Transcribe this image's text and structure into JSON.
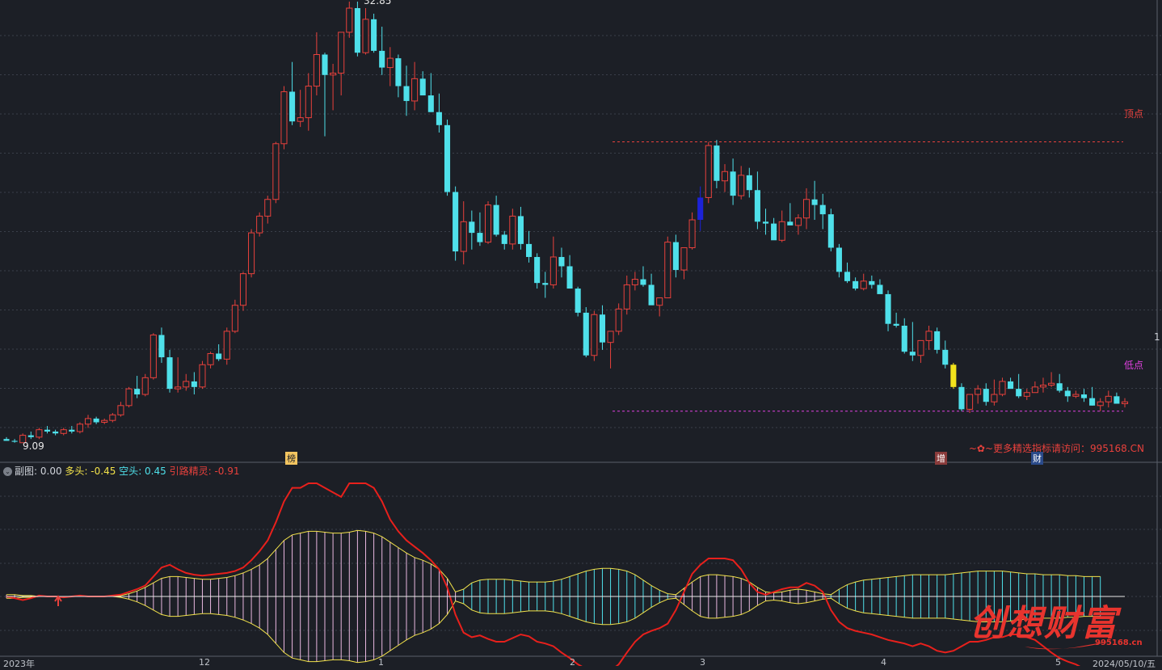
{
  "header": {
    "sub_label": "副图",
    "sub_value": ": 0.00",
    "duo_label": "多头",
    "duo_value": ": -0.45",
    "kong_label": "空头",
    "kong_value": ": 0.45",
    "yin_label": "引路精灵",
    "yin_value": ": -0.91",
    "promo": "~✿~更多精选指标请访问：995168.CN"
  },
  "markers": {
    "top_label": "顶点",
    "low_label": "低点",
    "low_price": "9.09",
    "high_price": "32.85",
    "right_tick": "1",
    "tag_bang": "榜",
    "tag_zeng": "增",
    "tag_cai": "财"
  },
  "x_ticks": [
    "2023年",
    "12",
    "1",
    "2",
    "3",
    "4",
    "5",
    "2024/05/10/五"
  ],
  "watermark": {
    "text": "创想财富",
    "url": "995168.cn"
  },
  "colors": {
    "up": "#e8413c",
    "down": "#4fe0ea",
    "hl_blue": "#1c22d8",
    "hl_yellow": "#f2e31c",
    "duo_fill": "#e9b7e0",
    "kong_fill": "#4fe0ea",
    "line_red": "#e8201c",
    "grid": "#3a3f4a"
  },
  "chart_data": {
    "type": "candlestick",
    "price_range": [
      9.09,
      32.85
    ],
    "top_level": 25.3,
    "low_level": 10.8,
    "candles": [
      [
        9.3,
        9.4,
        9.2,
        9.2
      ],
      [
        9.2,
        9.3,
        9.1,
        9.15
      ],
      [
        9.1,
        9.6,
        9.09,
        9.5
      ],
      [
        9.5,
        9.7,
        9.3,
        9.4
      ],
      [
        9.4,
        9.9,
        9.3,
        9.8
      ],
      [
        9.8,
        10.0,
        9.6,
        9.7
      ],
      [
        9.7,
        9.8,
        9.5,
        9.6
      ],
      [
        9.6,
        9.9,
        9.5,
        9.8
      ],
      [
        9.8,
        10.0,
        9.6,
        9.7
      ],
      [
        9.7,
        10.2,
        9.6,
        10.1
      ],
      [
        10.1,
        10.6,
        9.9,
        10.4
      ],
      [
        10.4,
        10.5,
        10.1,
        10.2
      ],
      [
        10.2,
        10.4,
        10.1,
        10.3
      ],
      [
        10.3,
        10.7,
        10.2,
        10.6
      ],
      [
        10.6,
        11.3,
        10.5,
        11.1
      ],
      [
        11.1,
        12.1,
        11.0,
        12.0
      ],
      [
        12.0,
        12.7,
        11.5,
        11.7
      ],
      [
        11.7,
        12.8,
        11.6,
        12.6
      ],
      [
        12.6,
        15.0,
        12.5,
        14.9
      ],
      [
        14.9,
        15.3,
        13.4,
        13.7
      ],
      [
        13.7,
        14.1,
        11.8,
        12.0
      ],
      [
        12.0,
        13.7,
        11.8,
        12.1
      ],
      [
        12.1,
        12.8,
        11.9,
        12.4
      ],
      [
        12.4,
        12.9,
        11.7,
        12.1
      ],
      [
        12.1,
        13.5,
        12.0,
        13.3
      ],
      [
        13.3,
        14.0,
        13.1,
        13.9
      ],
      [
        13.9,
        14.4,
        13.5,
        13.6
      ],
      [
        13.6,
        15.3,
        13.3,
        15.1
      ],
      [
        15.1,
        16.8,
        15.0,
        16.5
      ],
      [
        16.5,
        18.3,
        16.2,
        18.2
      ],
      [
        18.2,
        20.6,
        18.0,
        20.4
      ],
      [
        20.4,
        21.5,
        20.2,
        21.3
      ],
      [
        21.3,
        22.4,
        20.9,
        22.2
      ],
      [
        22.2,
        25.3,
        22.0,
        25.2
      ],
      [
        25.2,
        28.3,
        24.9,
        28.0
      ],
      [
        28.0,
        29.6,
        26.2,
        26.4
      ],
      [
        26.4,
        28.1,
        26.1,
        26.6
      ],
      [
        26.6,
        29.0,
        25.9,
        28.3
      ],
      [
        28.3,
        31.2,
        27.8,
        30.0
      ],
      [
        30.0,
        30.1,
        25.6,
        28.9
      ],
      [
        28.9,
        29.5,
        27.0,
        29.0
      ],
      [
        29.0,
        31.1,
        27.8,
        31.2
      ],
      [
        31.2,
        32.85,
        30.9,
        32.5
      ],
      [
        32.5,
        32.85,
        29.9,
        30.1
      ],
      [
        30.1,
        32.5,
        30.0,
        31.9
      ],
      [
        31.9,
        32.2,
        30.1,
        30.2
      ],
      [
        30.2,
        31.5,
        28.9,
        29.3
      ],
      [
        29.3,
        30.4,
        28.3,
        29.8
      ],
      [
        29.8,
        30.0,
        27.7,
        28.3
      ],
      [
        28.3,
        29.4,
        26.7,
        27.5
      ],
      [
        27.5,
        29.6,
        27.0,
        28.7
      ],
      [
        28.7,
        29.1,
        28.4,
        27.8
      ],
      [
        27.8,
        29.0,
        27.2,
        26.9
      ],
      [
        26.9,
        27.9,
        25.8,
        26.2
      ],
      [
        26.2,
        26.5,
        22.4,
        22.6
      ],
      [
        22.6,
        22.9,
        18.9,
        19.4
      ],
      [
        19.4,
        22.1,
        18.7,
        21.0
      ],
      [
        21.0,
        21.6,
        19.5,
        20.4
      ],
      [
        20.4,
        21.5,
        19.7,
        19.9
      ],
      [
        19.9,
        22.1,
        19.8,
        21.9
      ],
      [
        21.9,
        22.4,
        20.2,
        20.3
      ],
      [
        20.3,
        20.5,
        19.5,
        19.8
      ],
      [
        19.8,
        21.7,
        19.5,
        21.3
      ],
      [
        21.3,
        21.8,
        19.5,
        19.8
      ],
      [
        19.8,
        20.5,
        18.8,
        19.1
      ],
      [
        19.1,
        19.3,
        17.4,
        17.7
      ],
      [
        17.7,
        18.3,
        16.9,
        17.6
      ],
      [
        17.6,
        20.2,
        17.4,
        19.1
      ],
      [
        19.1,
        19.6,
        18.0,
        18.6
      ],
      [
        18.6,
        19.2,
        17.6,
        17.4
      ],
      [
        17.4,
        17.5,
        15.9,
        16.1
      ],
      [
        16.1,
        16.4,
        13.7,
        13.8
      ],
      [
        13.8,
        16.2,
        13.5,
        16.0
      ],
      [
        16.0,
        16.5,
        14.1,
        14.5
      ],
      [
        14.5,
        14.9,
        13.1,
        15.1
      ],
      [
        15.1,
        16.6,
        14.9,
        16.3
      ],
      [
        16.3,
        18.1,
        16.0,
        17.6
      ],
      [
        17.6,
        18.3,
        17.3,
        17.9
      ],
      [
        17.9,
        18.6,
        17.5,
        17.6
      ],
      [
        17.6,
        18.2,
        16.7,
        16.5
      ],
      [
        16.5,
        16.9,
        15.9,
        16.9
      ],
      [
        16.9,
        20.2,
        16.9,
        19.9
      ],
      [
        19.9,
        20.3,
        18.0,
        18.4
      ],
      [
        18.4,
        19.4,
        17.9,
        19.6
      ],
      [
        19.6,
        21.5,
        19.5,
        21.1
      ],
      [
        21.1,
        22.9,
        20.5,
        22.3
      ],
      [
        22.3,
        25.3,
        22.0,
        25.1
      ],
      [
        25.1,
        25.4,
        22.8,
        23.2
      ],
      [
        23.2,
        24.1,
        22.6,
        23.7
      ],
      [
        23.7,
        24.4,
        21.9,
        22.4
      ],
      [
        22.4,
        24.0,
        22.2,
        23.5
      ],
      [
        23.5,
        23.9,
        22.3,
        22.7
      ],
      [
        22.7,
        23.7,
        20.6,
        21.0
      ],
      [
        21.0,
        21.7,
        20.3,
        20.9
      ],
      [
        20.9,
        21.2,
        20.1,
        20.0
      ],
      [
        20.0,
        21.6,
        19.9,
        21.0
      ],
      [
        21.0,
        22.0,
        20.9,
        20.8
      ],
      [
        20.8,
        21.4,
        20.3,
        21.2
      ],
      [
        21.2,
        22.8,
        20.6,
        22.2
      ],
      [
        22.2,
        23.2,
        21.1,
        21.9
      ],
      [
        21.9,
        22.5,
        20.6,
        21.4
      ],
      [
        21.4,
        21.7,
        19.4,
        19.6
      ],
      [
        19.6,
        19.8,
        18.0,
        18.3
      ],
      [
        18.3,
        18.8,
        17.7,
        17.8
      ],
      [
        17.8,
        18.0,
        17.3,
        17.4
      ],
      [
        17.4,
        18.2,
        17.3,
        17.8
      ],
      [
        17.8,
        18.1,
        17.4,
        17.6
      ],
      [
        17.6,
        17.9,
        17.2,
        17.1
      ],
      [
        17.1,
        17.3,
        15.1,
        15.5
      ],
      [
        15.5,
        16.1,
        15.3,
        15.4
      ],
      [
        15.4,
        15.8,
        13.9,
        14.0
      ],
      [
        14.0,
        15.6,
        13.5,
        13.8
      ],
      [
        13.8,
        14.4,
        13.4,
        14.6
      ],
      [
        14.6,
        15.4,
        14.1,
        15.1
      ],
      [
        15.1,
        15.3,
        13.9,
        14.1
      ],
      [
        14.1,
        14.6,
        13.1,
        13.3
      ],
      [
        13.3,
        13.4,
        12.0,
        12.1
      ],
      [
        12.1,
        12.3,
        10.8,
        10.9
      ],
      [
        10.9,
        11.6,
        10.7,
        11.7
      ],
      [
        11.7,
        12.2,
        11.2,
        12.0
      ],
      [
        12.0,
        12.3,
        11.1,
        11.3
      ],
      [
        11.3,
        12.5,
        11.1,
        11.7
      ],
      [
        11.7,
        12.6,
        11.6,
        12.4
      ],
      [
        12.4,
        12.6,
        12.3,
        12.0
      ],
      [
        12.0,
        12.8,
        11.5,
        11.6
      ],
      [
        11.6,
        12.0,
        11.4,
        11.8
      ],
      [
        11.8,
        12.4,
        11.8,
        12.1
      ],
      [
        12.1,
        12.6,
        11.8,
        12.2
      ],
      [
        12.2,
        12.9,
        12.1,
        12.3
      ],
      [
        12.3,
        12.8,
        11.8,
        11.9
      ],
      [
        11.9,
        12.1,
        11.3,
        11.6
      ],
      [
        11.6,
        11.9,
        11.5,
        11.7
      ],
      [
        11.7,
        12.0,
        11.3,
        11.5
      ],
      [
        11.5,
        12.1,
        11.1,
        11.1
      ],
      [
        11.1,
        11.5,
        10.8,
        11.3
      ],
      [
        11.3,
        11.9,
        11.0,
        11.6
      ],
      [
        11.6,
        11.8,
        11.4,
        11.2
      ],
      [
        11.2,
        11.5,
        11.0,
        11.3
      ]
    ],
    "highlight": {
      "blue_index": 85,
      "yellow_index": 116
    },
    "indicator": {
      "range": [
        -1.0,
        1.0
      ],
      "duo": [
        0.02,
        0.02,
        0.01,
        0.01,
        0.0,
        0.0,
        0.0,
        0.0,
        0.0,
        0.0,
        0.0,
        0.0,
        0.0,
        0.0,
        0.01,
        0.03,
        0.06,
        0.1,
        0.15,
        0.2,
        0.22,
        0.22,
        0.21,
        0.2,
        0.19,
        0.19,
        0.2,
        0.21,
        0.23,
        0.26,
        0.3,
        0.35,
        0.42,
        0.52,
        0.62,
        0.68,
        0.7,
        0.72,
        0.72,
        0.71,
        0.7,
        0.7,
        0.71,
        0.73,
        0.72,
        0.7,
        0.66,
        0.6,
        0.54,
        0.48,
        0.43,
        0.4,
        0.36,
        0.3,
        0.2,
        0.05,
        -0.08,
        -0.15,
        -0.18,
        -0.19,
        -0.19,
        -0.19,
        -0.18,
        -0.17,
        -0.16,
        -0.16,
        -0.16,
        -0.17,
        -0.19,
        -0.22,
        -0.25,
        -0.28,
        -0.3,
        -0.31,
        -0.31,
        -0.3,
        -0.28,
        -0.24,
        -0.18,
        -0.12,
        -0.07,
        -0.03,
        0.02,
        0.09,
        0.16,
        0.22,
        0.24,
        0.24,
        0.23,
        0.22,
        0.2,
        0.16,
        0.1,
        0.05,
        0.04,
        0.05,
        0.07,
        0.08,
        0.07,
        0.05,
        0.03,
        -0.02,
        -0.08,
        -0.13,
        -0.16,
        -0.18,
        -0.19,
        -0.2,
        -0.21,
        -0.22,
        -0.23,
        -0.24,
        -0.24,
        -0.24,
        -0.24,
        -0.24,
        -0.25,
        -0.26,
        -0.27,
        -0.28,
        -0.28,
        -0.28,
        -0.28,
        -0.27,
        -0.26,
        -0.25,
        -0.25,
        -0.24,
        -0.24,
        -0.24,
        -0.23,
        -0.23,
        -0.22,
        -0.22,
        -0.22
      ],
      "yin": [
        0.0,
        -0.02,
        -0.04,
        -0.02,
        0.01,
        0.0,
        0.0,
        -0.01,
        0.0,
        0.01,
        0.0,
        0.0,
        0.0,
        0.01,
        0.02,
        0.05,
        0.08,
        0.12,
        0.22,
        0.32,
        0.35,
        0.3,
        0.26,
        0.24,
        0.23,
        0.24,
        0.25,
        0.26,
        0.28,
        0.32,
        0.4,
        0.5,
        0.62,
        0.82,
        1.05,
        1.2,
        1.2,
        1.25,
        1.25,
        1.2,
        1.15,
        1.1,
        1.25,
        1.25,
        1.25,
        1.2,
        1.05,
        0.85,
        0.72,
        0.62,
        0.55,
        0.48,
        0.4,
        0.3,
        0.1,
        -0.2,
        -0.4,
        -0.45,
        -0.43,
        -0.47,
        -0.5,
        -0.5,
        -0.46,
        -0.42,
        -0.44,
        -0.5,
        -0.52,
        -0.55,
        -0.62,
        -0.68,
        -0.75,
        -0.8,
        -0.82,
        -0.8,
        -0.82,
        -0.75,
        -0.62,
        -0.5,
        -0.42,
        -0.38,
        -0.35,
        -0.3,
        -0.15,
        0.05,
        0.25,
        0.35,
        0.42,
        0.42,
        0.42,
        0.4,
        0.3,
        0.15,
        0.05,
        0.02,
        0.05,
        0.08,
        0.1,
        0.1,
        0.15,
        0.12,
        0.05,
        -0.15,
        -0.28,
        -0.35,
        -0.38,
        -0.4,
        -0.42,
        -0.45,
        -0.48,
        -0.5,
        -0.52,
        -0.55,
        -0.52,
        -0.55,
        -0.6,
        -0.62,
        -0.6,
        -0.55,
        -0.5,
        -0.5,
        -0.48,
        -0.45,
        -0.45,
        -0.42,
        -0.42,
        -0.45,
        -0.48,
        -0.55,
        -0.62,
        -0.68,
        -0.72,
        -0.75,
        -0.8,
        -0.85,
        -0.9,
        -0.91
      ]
    }
  }
}
